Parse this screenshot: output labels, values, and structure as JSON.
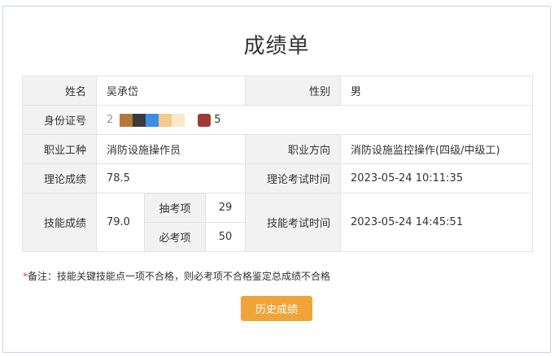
{
  "title": "成绩单",
  "info": {
    "name_label": "姓名",
    "name_value": "吴承岱",
    "gender_label": "性别",
    "gender_value": "男",
    "id_label": "身份证号",
    "id_first_char": "2",
    "id_last_char": "5",
    "id_mask_colors": [
      "#b5783a",
      "#3a3a3a",
      "#3a8ee6",
      "#f5c98a",
      "#fbe8c8",
      "#ffffff",
      "#a33a3a"
    ],
    "job_label": "职业工种",
    "job_value": "消防设施操作员",
    "direction_label": "职业方向",
    "direction_value": "消防设施监控操作(四级/中级工)",
    "theory_label": "理论成绩",
    "theory_value": "78.5",
    "theory_time_label": "理论考试时间",
    "theory_time_value": "2023-05-24 10:11:35",
    "skill_label": "技能成绩",
    "skill_value": "79.0",
    "draw_label": "抽考项",
    "draw_value": "29",
    "must_label": "必考项",
    "must_value": "50",
    "skill_time_label": "技能考试时间",
    "skill_time_value": "2023-05-24 14:45:51"
  },
  "note": {
    "star": "*",
    "text": "备注：技能关键技能点一项不合格，则必考项不合格鉴定总成绩不合格"
  },
  "history_button_label": "历史成绩",
  "colors": {
    "accent_button": "#efa43a",
    "link": "#3a8ee6",
    "label_bg": "#f2f2f2"
  }
}
